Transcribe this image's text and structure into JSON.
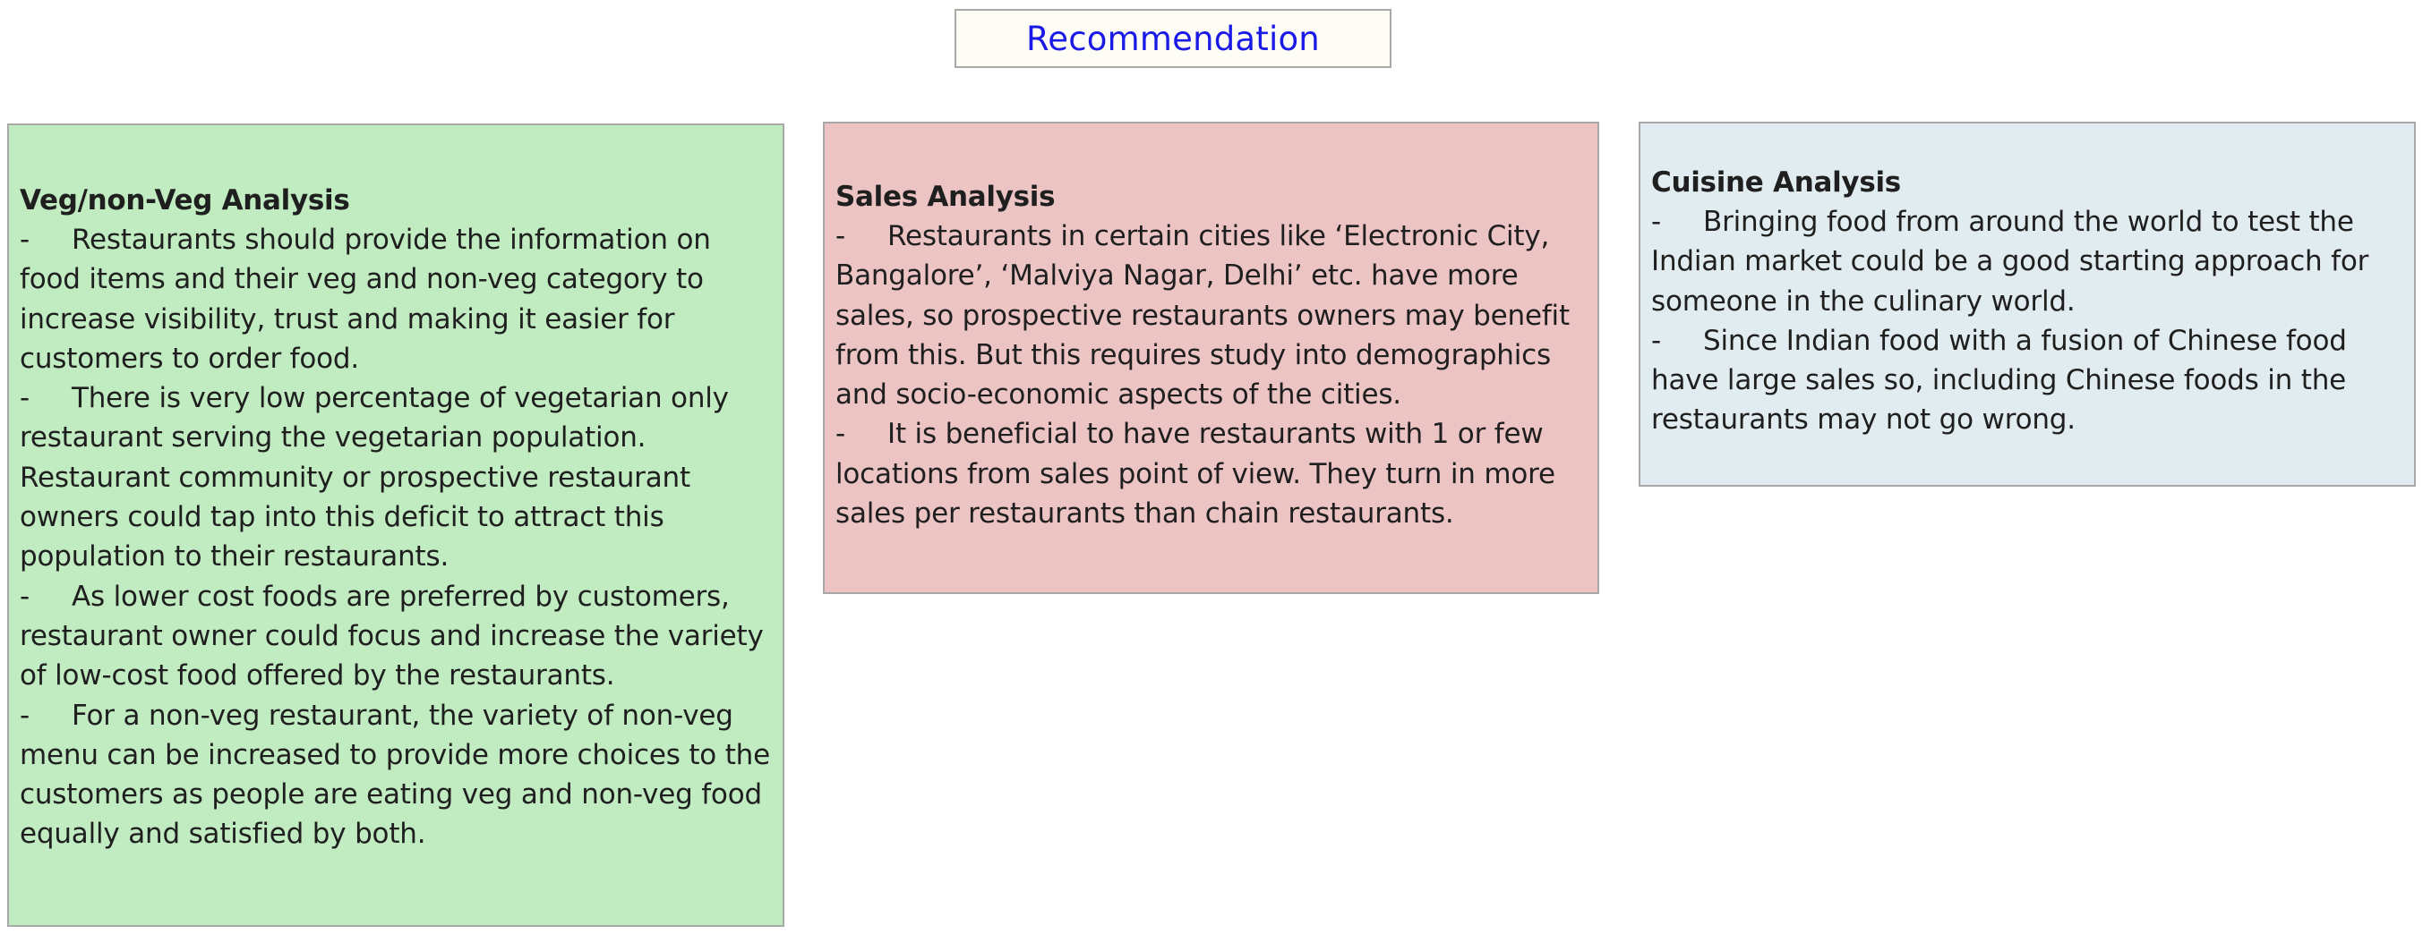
{
  "title": "Recommendation",
  "panels": {
    "veg": {
      "heading": "Veg/non-Veg Analysis",
      "items": [
        "Restaurants should provide the information on food items and their veg and non-veg category to increase visibility, trust and making it easier for customers to order food.",
        "There is very low percentage of vegetarian only restaurant serving the vegetarian population. Restaurant community or prospective restaurant owners could tap into this deficit to attract this population to their restaurants.",
        "As lower cost foods are preferred by customers, restaurant owner could focus and increase the variety of low-cost food offered by the restaurants.",
        "For a non-veg restaurant, the variety of non-veg menu can be increased to provide more choices to the customers as people are eating veg and non-veg food equally and satisfied by both."
      ]
    },
    "sales": {
      "heading": "Sales Analysis",
      "items": [
        "Restaurants in certain cities like ‘Electronic City, Bangalore’, ‘Malviya Nagar, Delhi’ etc. have more sales, so prospective restaurants owners may benefit from this. But this requires study into demographics and socio-economic aspects of the cities.",
        "It is beneficial to have restaurants with 1 or few locations from sales point of view. They turn in more sales per restaurants than chain restaurants."
      ]
    },
    "cuisine": {
      "heading": "Cuisine Analysis",
      "items": [
        "Bringing food from around the world to test the Indian market could be a good starting approach for someone in the culinary world.",
        "Since Indian food with a fusion of Chinese food have large sales so, including Chinese foods in the restaurants may not go wrong."
      ]
    }
  },
  "bullet_char": "-",
  "colors": {
    "title_text": "#1a1ae6",
    "title_bg": "#fefdf5",
    "veg_bg": "#c1ebc1",
    "sales_bg": "#ecc4c4",
    "cuisine_bg": "#e1ecf0"
  }
}
